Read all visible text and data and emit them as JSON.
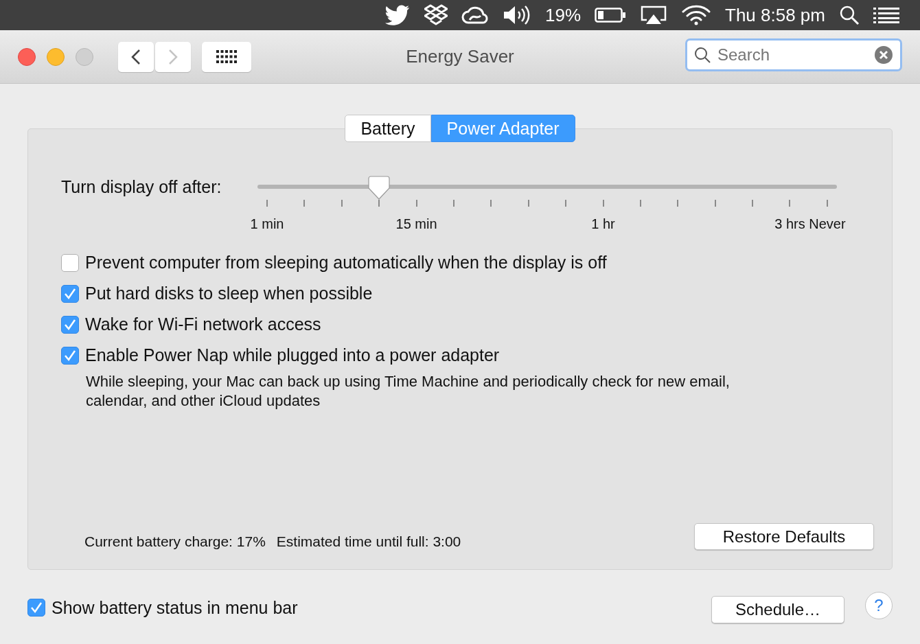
{
  "menu_bar": {
    "battery_percent": "19%",
    "clock": "Thu 8:58 pm"
  },
  "window": {
    "title": "Energy Saver",
    "search": {
      "placeholder": "Search"
    }
  },
  "navigation": [
    {
      "kind": "back",
      "disabled": false
    },
    {
      "kind": "forward",
      "disabled": true
    }
  ],
  "tabs": [
    {
      "label": "Battery",
      "selected": false
    },
    {
      "label": "Power Adapter",
      "selected": true
    }
  ],
  "display_sleep": {
    "label": "Turn display off after:",
    "level": 0.2,
    "scale_labels": [
      "1 min",
      "15 min",
      "1 hr",
      "3 hrs",
      "Never"
    ]
  },
  "options": [
    {
      "label": "Prevent computer from sleeping automatically when the display is off",
      "checked": false
    },
    {
      "label": "Put hard disks to sleep when possible",
      "checked": true
    },
    {
      "label": "Wake for Wi-Fi network access",
      "checked": true
    },
    {
      "label": "Enable Power Nap while plugged into a power adapter",
      "checked": true,
      "description": "While sleeping, your Mac can back up using Time Machine and periodically check for new email, calendar, and other iCloud updates"
    }
  ],
  "status": [
    "Current battery charge: 17%",
    "Estimated time until full: 3:00"
  ],
  "restore_button": "Restore Defaults",
  "show_battery_status": {
    "label": "Show battery status in menu bar",
    "checked": true
  },
  "schedule_button": "Schedule…",
  "help_button": "?"
}
